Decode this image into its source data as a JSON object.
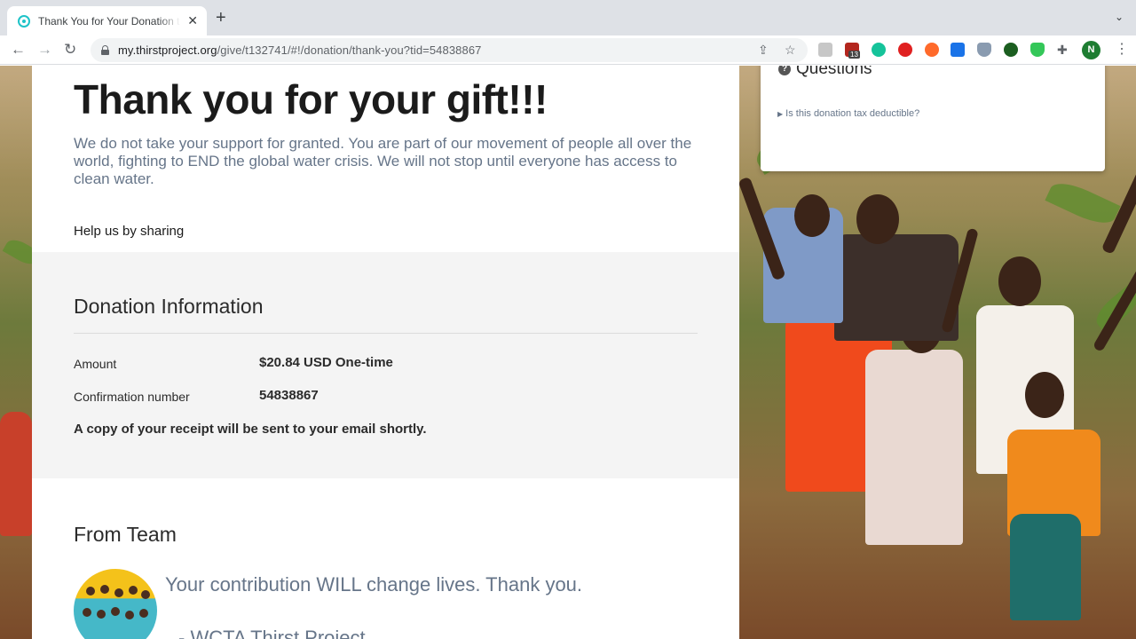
{
  "browser": {
    "tab_title": "Thank You for Your Donation to",
    "url_host": "my.thirstproject.org",
    "url_path": "/give/t132741/#!/donation/thank-you?tid=54838867",
    "profile_initial": "N",
    "extension_badge": "13"
  },
  "page": {
    "heading": "Thank you for your gift!!!",
    "intro": "We do not take your support for granted. You are part of our movement of people all over the world, fighting to END the global water crisis. We will not stop until everyone has access to clean water.",
    "share_label": "Help us by sharing"
  },
  "donation": {
    "title": "Donation Information",
    "amount_label": "Amount",
    "amount_value": "$20.84 USD One-time",
    "confirmation_label": "Confirmation number",
    "confirmation_value": "54838867",
    "receipt_note": "A copy of your receipt will be sent to your email shortly."
  },
  "team": {
    "title": "From Team",
    "message": "Your contribution WILL change lives. Thank you.",
    "signature": "- WCTA Thirst Project"
  },
  "questions": {
    "title": "Questions",
    "items": [
      "Is this donation tax deductible?"
    ]
  }
}
